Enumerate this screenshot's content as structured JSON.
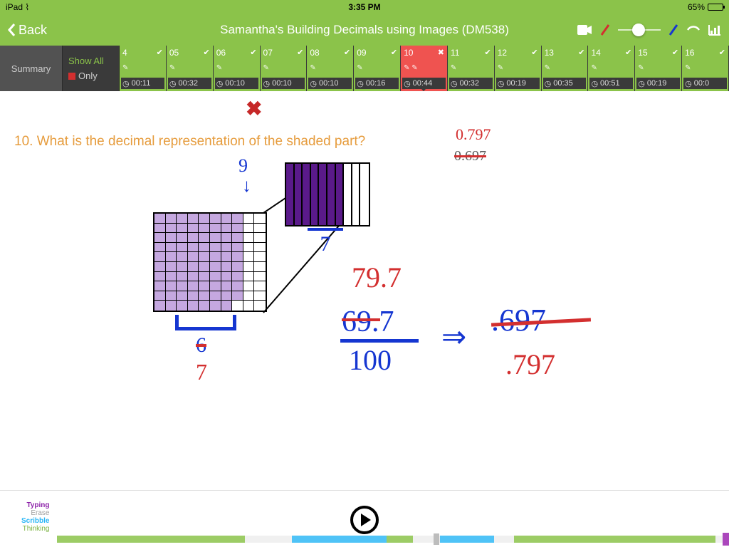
{
  "status": {
    "device": "iPad",
    "time": "3:35 PM",
    "battery": "65%"
  },
  "header": {
    "back": "Back",
    "title": "Samantha's Building Decimals using Images (DM538)"
  },
  "filter": {
    "summary": "Summary",
    "showAll": "Show All",
    "only": "Only"
  },
  "thumbs": [
    {
      "n": "4",
      "ok": true,
      "t": "00:11",
      "active": false
    },
    {
      "n": "05",
      "ok": true,
      "t": "00:32",
      "active": false
    },
    {
      "n": "06",
      "ok": true,
      "t": "00:10",
      "active": false
    },
    {
      "n": "07",
      "ok": true,
      "t": "00:10",
      "active": false
    },
    {
      "n": "08",
      "ok": true,
      "t": "00:10",
      "active": false
    },
    {
      "n": "09",
      "ok": true,
      "t": "00:16",
      "active": false
    },
    {
      "n": "10",
      "ok": false,
      "t": "00:44",
      "active": true
    },
    {
      "n": "11",
      "ok": true,
      "t": "00:32",
      "active": false
    },
    {
      "n": "12",
      "ok": true,
      "t": "00:19",
      "active": false
    },
    {
      "n": "13",
      "ok": true,
      "t": "00:35",
      "active": false
    },
    {
      "n": "14",
      "ok": true,
      "t": "00:51",
      "active": false
    },
    {
      "n": "15",
      "ok": true,
      "t": "00:19",
      "active": false
    },
    {
      "n": "16",
      "ok": true,
      "t": "00:0",
      "active": false
    }
  ],
  "question": "10. What is the decimal representation of the shaded part?",
  "answers": {
    "correct": "0.797",
    "wrong": "0.697"
  },
  "work": {
    "top_digit": "9",
    "zoom_digit": "7",
    "bottom_strike": "6",
    "bottom_new": "7",
    "line1": "79.7",
    "frac_top": "69.7",
    "frac_bot": "100",
    "arrow": "⇒",
    "res_wrong": ".697",
    "res_right": ".797"
  },
  "legend": {
    "t1": "Typing",
    "t2": "Erase",
    "t3": "Scribble",
    "t4": "Thinking"
  }
}
